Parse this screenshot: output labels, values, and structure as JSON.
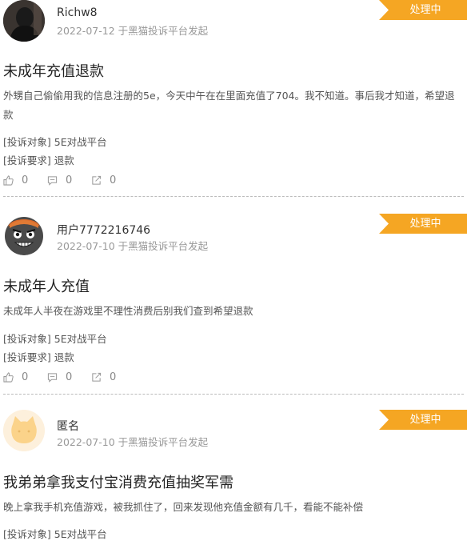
{
  "complaints": [
    {
      "username": "Richw8",
      "meta": "2022-07-12 于黑猫投诉平台发起",
      "status": "处理中",
      "title": "未成年充值退款",
      "description": "外甥自己偷偷用我的信息注册的5e，今天中午在在里面充值了704。我不知道。事后我才知道，希望退款",
      "target_label": "[投诉对象]",
      "target_value": "5E对战平台",
      "demand_label": "[投诉要求]",
      "demand_value": "退款",
      "likes": "0",
      "comments": "0",
      "shares": "0"
    },
    {
      "username": "用户7772216746",
      "meta": "2022-07-10 于黑猫投诉平台发起",
      "status": "处理中",
      "title": "未成年人充值",
      "description": "未成年人半夜在游戏里不理性消费后别我们查到希望退款",
      "target_label": "[投诉对象]",
      "target_value": "5E对战平台",
      "demand_label": "[投诉要求]",
      "demand_value": "退款",
      "likes": "0",
      "comments": "0",
      "shares": "0"
    },
    {
      "username": "匿名",
      "meta": "2022-07-10 于黑猫投诉平台发起",
      "status": "处理中",
      "title": "我弟弟拿我支付宝消费充值抽奖军需",
      "description": "晚上拿我手机充值游戏，被我抓住了，回来发现他充值金额有几千，看能不能补偿",
      "target_label": "[投诉对象]",
      "target_value": "5E对战平台"
    }
  ],
  "colors": {
    "badge": "#f5a623",
    "meta_text": "#999999",
    "body_text": "#555555"
  },
  "icons": {
    "like": "thumbs-up-icon",
    "comment": "comment-icon",
    "share": "share-icon"
  }
}
